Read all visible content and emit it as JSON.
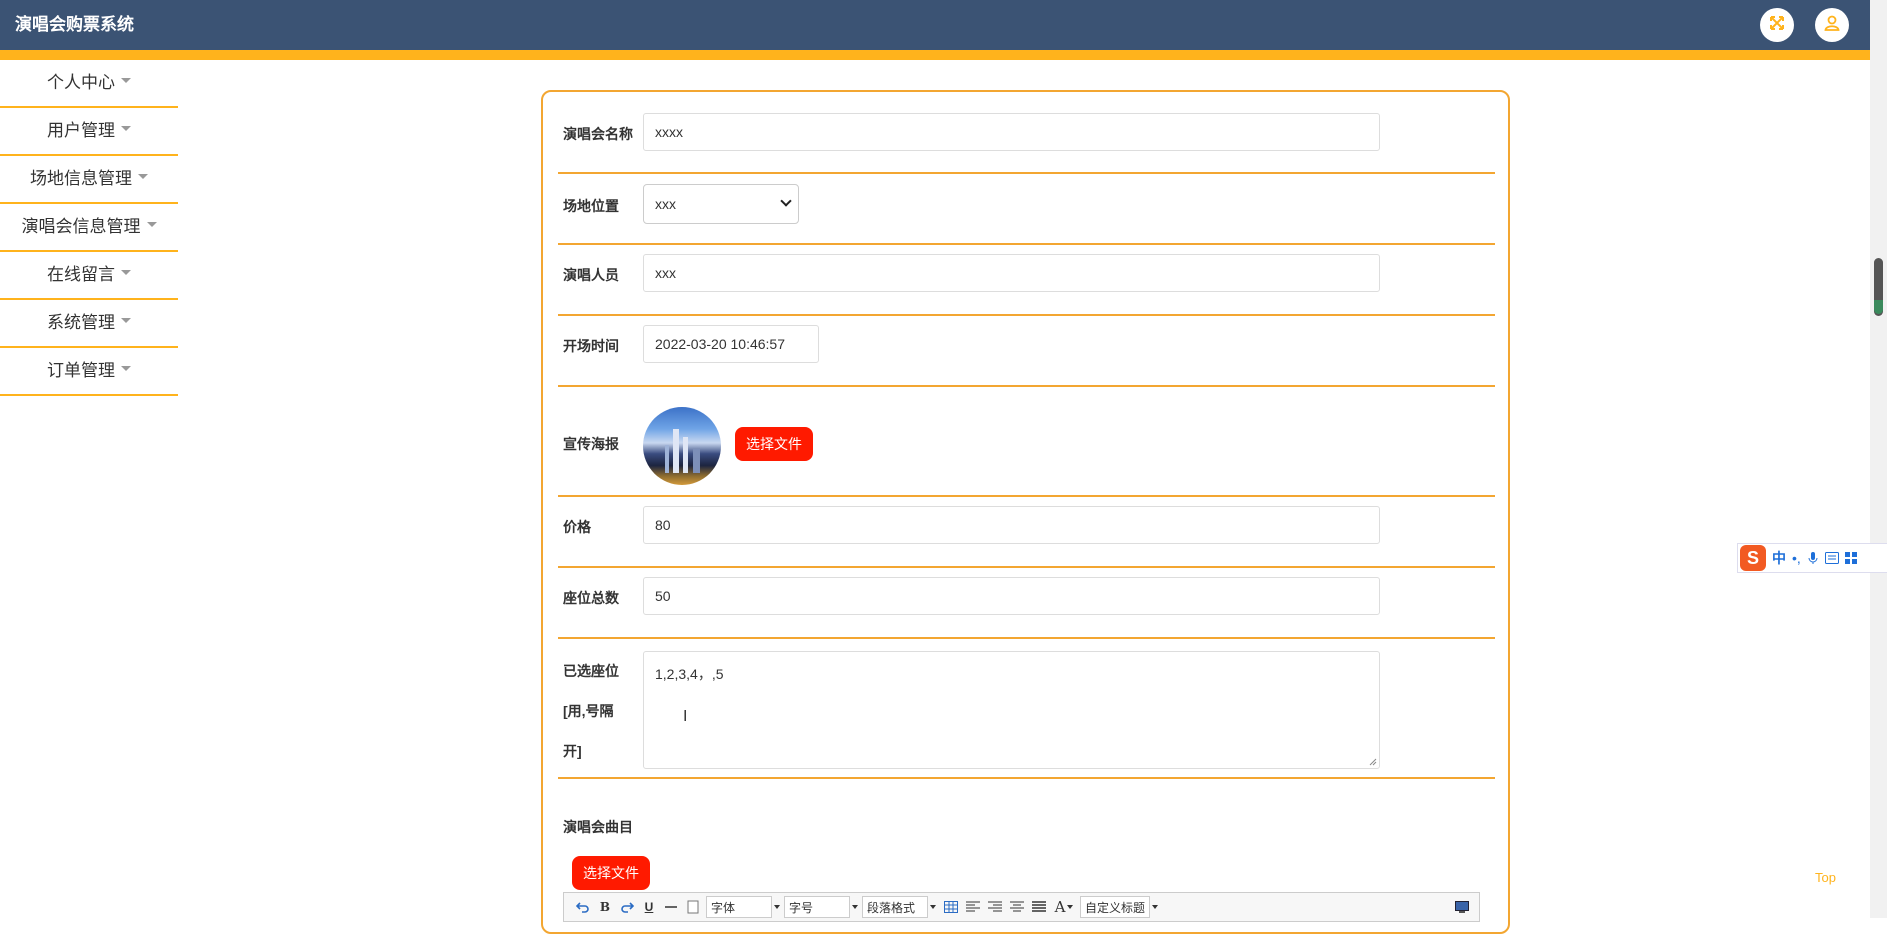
{
  "app": {
    "title": "演唱会购票系统"
  },
  "header": {
    "fullscreen_icon": "expand-icon",
    "user_icon": "user-icon"
  },
  "sidebar": {
    "items": [
      {
        "label": "个人中心"
      },
      {
        "label": "用户管理"
      },
      {
        "label": "场地信息管理"
      },
      {
        "label": "演唱会信息管理"
      },
      {
        "label": "在线留言"
      },
      {
        "label": "系统管理"
      },
      {
        "label": "订单管理"
      }
    ]
  },
  "form": {
    "name": {
      "label": "演唱会名称",
      "value": "xxxx"
    },
    "venue": {
      "label": "场地位置",
      "value": "xxx"
    },
    "performers": {
      "label": "演唱人员",
      "value": "xxx"
    },
    "start_time": {
      "label": "开场时间",
      "value": "2022-03-20 10:46:57"
    },
    "poster": {
      "label": "宣传海报",
      "button": "选择文件"
    },
    "price": {
      "label": "价格",
      "value": "80"
    },
    "total_seats": {
      "label": "座位总数",
      "value": "50"
    },
    "selected_seats": {
      "label_line1": "已选座位",
      "label_line2": "[用,号隔",
      "label_line3": "开]",
      "value": "1,2,3,4，,5"
    },
    "songs": {
      "label": "演唱会曲目",
      "button": "选择文件"
    }
  },
  "editor_toolbar": {
    "font_family": "字体",
    "font_size": "字号",
    "paragraph": "段落格式",
    "custom_title": "自定义标题"
  },
  "ime": {
    "mode": "中"
  },
  "back_to_top": "Top",
  "colors": {
    "header": "#3b5374",
    "accent": "#ffb31c",
    "button": "#ff1a00"
  }
}
